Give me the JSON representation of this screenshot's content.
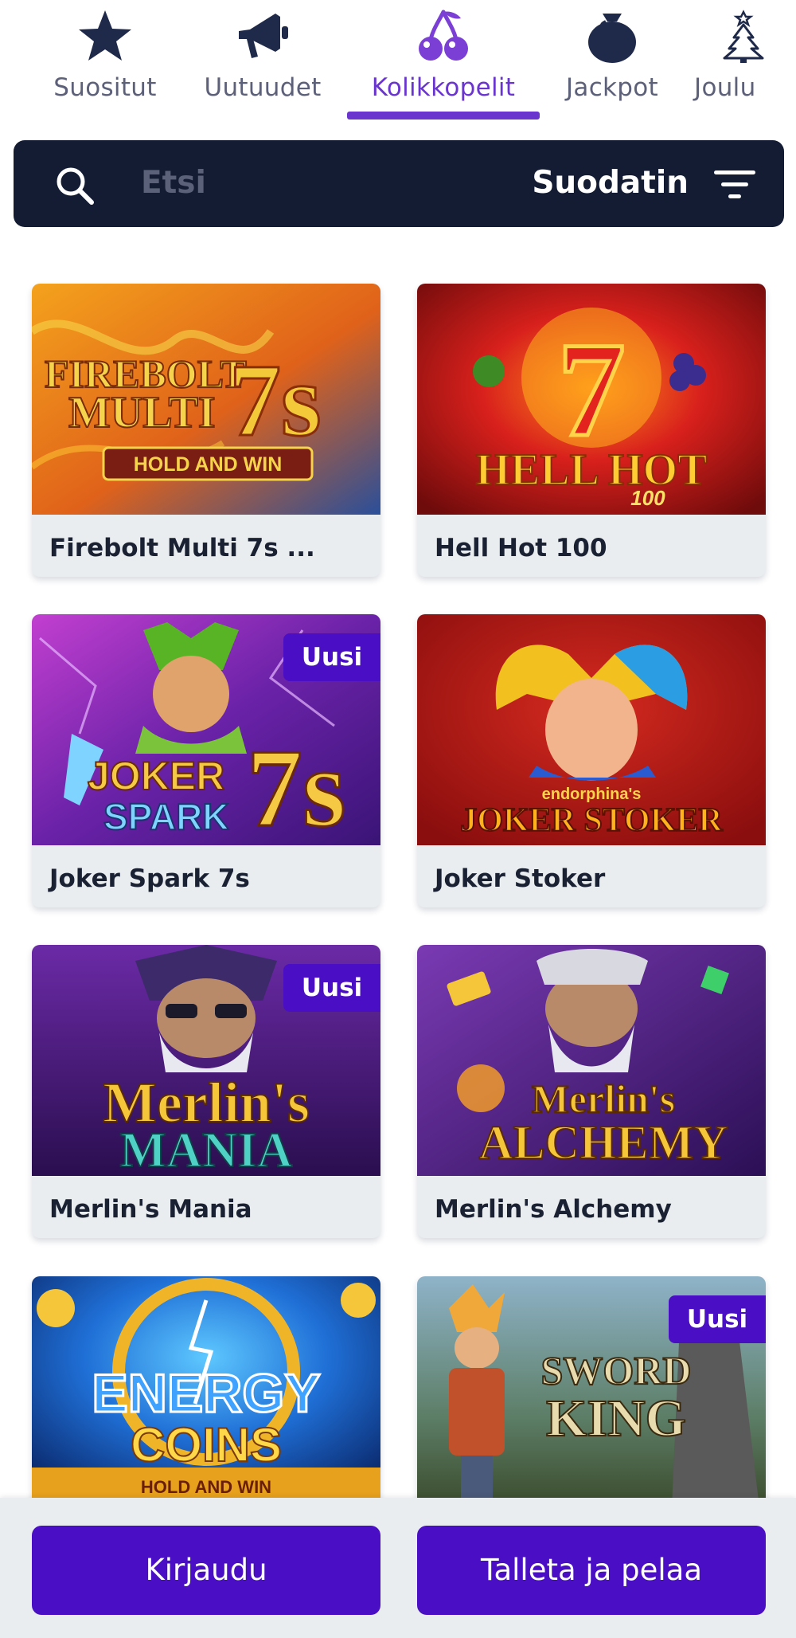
{
  "nav": {
    "items": [
      {
        "label": "Suositut",
        "icon": "star-icon"
      },
      {
        "label": "Uutuudet",
        "icon": "megaphone-icon"
      },
      {
        "label": "Kolikkopelit",
        "icon": "cherry-icon",
        "active": true
      },
      {
        "label": "Jackpot",
        "icon": "moneybag-icon"
      },
      {
        "label": "Joulu",
        "icon": "christmas-tree-icon"
      }
    ]
  },
  "search": {
    "placeholder": "Etsi",
    "filter_label": "Suodatin"
  },
  "games": [
    {
      "title": "Firebolt Multi 7s ...",
      "art_lines": [
        "FIREBOLT",
        "MULTI",
        "HOLD AND WIN"
      ],
      "art_big": "7s",
      "new": false
    },
    {
      "title": "Hell Hot 100",
      "art_lines": [
        "HELL HOT",
        "100"
      ],
      "art_big": "7",
      "new": false
    },
    {
      "title": "Joker Spark 7s",
      "art_lines": [
        "JOKER",
        "SPARK"
      ],
      "art_big": "7s",
      "new": true
    },
    {
      "title": "Joker Stoker",
      "art_lines": [
        "endorphina's",
        "JOKER STOKER"
      ],
      "art_big": "",
      "new": false
    },
    {
      "title": "Merlin's Mania",
      "art_lines": [
        "Merlin's",
        "MANIA"
      ],
      "art_big": "",
      "new": true
    },
    {
      "title": "Merlin's Alchemy",
      "art_lines": [
        "Merlin's",
        "ALCHEMY"
      ],
      "art_big": "",
      "new": false
    },
    {
      "title": "",
      "art_lines": [
        "ENERGY",
        "COINS",
        "HOLD AND WIN"
      ],
      "art_big": "",
      "new": false
    },
    {
      "title": "",
      "art_lines": [
        "SWORD",
        "KING"
      ],
      "art_big": "",
      "new": true
    }
  ],
  "badge_label": "Uusi",
  "actions": {
    "login_label": "Kirjaudu",
    "deposit_label": "Talleta ja pelaa"
  },
  "colors": {
    "primary": "#4a0fc4",
    "nav_active": "#6a35cf",
    "search_bg": "#131c33",
    "card_bg": "#e9edf0"
  }
}
